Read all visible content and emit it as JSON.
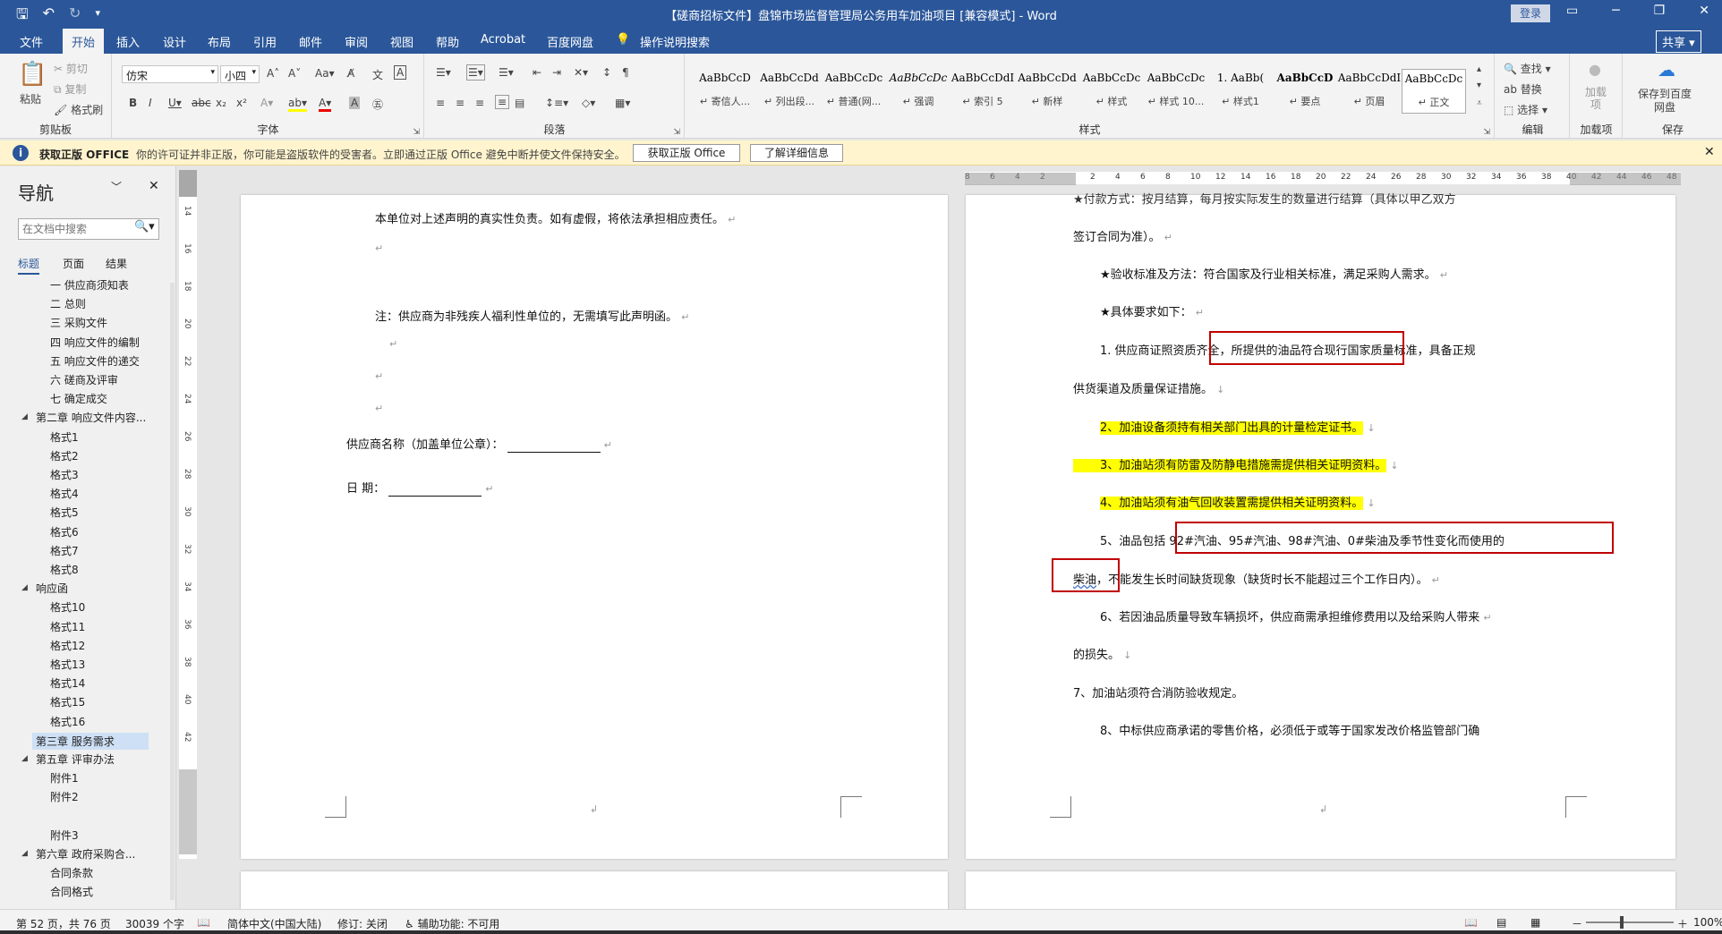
{
  "titlebar": {
    "title": "【磋商招标文件】盘锦市场监督管理局公务用车加油项目 [兼容模式] - Word",
    "login": "登录",
    "save_icon": "save-icon",
    "undo_icon": "undo-icon",
    "redo_icon": "redo-icon"
  },
  "tabs": [
    "文件",
    "开始",
    "插入",
    "设计",
    "布局",
    "引用",
    "邮件",
    "审阅",
    "视图",
    "帮助",
    "Acrobat",
    "百度网盘"
  ],
  "tell_me": "操作说明搜索",
  "share": "共享",
  "ribbon": {
    "clipboard": {
      "paste": "粘贴",
      "cut": "剪切",
      "copy": "复制",
      "format_painter": "格式刷",
      "label": "剪贴板"
    },
    "font": {
      "name": "仿宋",
      "size": "小四",
      "label": "字体"
    },
    "paragraph": {
      "label": "段落"
    },
    "styles": {
      "label": "样式",
      "items": [
        {
          "preview": "AaBbCcD",
          "name": "寄信人..."
        },
        {
          "preview": "AaBbCcDd",
          "name": "列出段..."
        },
        {
          "preview": "AaBbCcDc",
          "name": "普通(网..."
        },
        {
          "preview": "AaBbCcDc",
          "name": "强调"
        },
        {
          "preview": "AaBbCcDdI",
          "name": "索引 5"
        },
        {
          "preview": "AaBbCcDd",
          "name": "新样"
        },
        {
          "preview": "AaBbCcDc",
          "name": "样式"
        },
        {
          "preview": "AaBbCcDc",
          "name": "样式 10..."
        },
        {
          "preview": "1. AaBb(",
          "name": "样式1"
        },
        {
          "preview": "AaBbCcD",
          "name": "要点"
        },
        {
          "preview": "AaBbCcDdI",
          "name": "页眉"
        },
        {
          "preview": "AaBbCcDc",
          "name": "正文"
        }
      ]
    },
    "editing": {
      "find": "查找",
      "replace": "替换",
      "select": "选择",
      "label": "编辑"
    },
    "addins": {
      "label": "加载项",
      "btn": "加载项"
    },
    "save": {
      "btn": "保存到百度网盘",
      "label": "保存"
    }
  },
  "infobar": {
    "title": "获取正版 OFFICE",
    "message": "你的许可证并非正版，你可能是盗版软件的受害者。立即通过正版 Office 避免中断并使文件保持安全。",
    "btn1": "获取正版 Office",
    "btn2": "了解详细信息"
  },
  "nav": {
    "title": "导航",
    "search_placeholder": "在文档中搜索",
    "tabs": [
      "标题",
      "页面",
      "结果"
    ],
    "items": [
      {
        "label": "一 供应商须知表",
        "indent": 2
      },
      {
        "label": "二 总则",
        "indent": 2
      },
      {
        "label": "三 采购文件",
        "indent": 2
      },
      {
        "label": "四  响应文件的编制",
        "indent": 2
      },
      {
        "label": "五 响应文件的递交",
        "indent": 2
      },
      {
        "label": "六 磋商及评审",
        "indent": 2
      },
      {
        "label": "七 确定成交",
        "indent": 2
      },
      {
        "label": "第二章 响应文件内容...",
        "indent": 1,
        "expand": true
      },
      {
        "label": "格式1",
        "indent": 2
      },
      {
        "label": "格式2",
        "indent": 2
      },
      {
        "label": "格式3",
        "indent": 2
      },
      {
        "label": "格式4",
        "indent": 2
      },
      {
        "label": "格式5",
        "indent": 2
      },
      {
        "label": "格式6",
        "indent": 2
      },
      {
        "label": "格式7",
        "indent": 2
      },
      {
        "label": "格式8",
        "indent": 2
      },
      {
        "label": "响应函",
        "indent": 1,
        "expand": true
      },
      {
        "label": "格式10",
        "indent": 2
      },
      {
        "label": "格式11",
        "indent": 2
      },
      {
        "label": "格式12",
        "indent": 2
      },
      {
        "label": "格式13",
        "indent": 2
      },
      {
        "label": "格式14",
        "indent": 2
      },
      {
        "label": "格式15",
        "indent": 2
      },
      {
        "label": "格式16",
        "indent": 2
      },
      {
        "label": "第三章  服务需求",
        "indent": 1,
        "selected": true
      },
      {
        "label": "第五章 评审办法",
        "indent": 1,
        "expand": true
      },
      {
        "label": "附件1",
        "indent": 2
      },
      {
        "label": "附件2",
        "indent": 2
      },
      {
        "label": "",
        "indent": 2
      },
      {
        "label": "附件3",
        "indent": 2
      },
      {
        "label": "第六章  政府采购合...",
        "indent": 1,
        "expand": true
      },
      {
        "label": "合同条款",
        "indent": 2
      },
      {
        "label": "合同格式",
        "indent": 2
      }
    ]
  },
  "left_page": {
    "p1": "本单位对上述声明的真实性负责。如有虚假，将依法承担相应责任。",
    "p2": "注：供应商为非残疾人福利性单位的，无需填写此声明函。",
    "p3": "供应商名称（加盖单位公章）：",
    "p4": "日  期："
  },
  "right_page": {
    "l0": "★付款方式：按月结算，每月按实际发生的数量进行结算（具体以甲乙双方",
    "l1": "签订合同为准）。",
    "l2": "★验收标准及方法：符合国家及行业相关标准，满足采购人需求。",
    "l3": "★具体要求如下：",
    "l4a": "1. 供应商证照资质齐全，",
    "l4b": "所提供的油品符合现行国家质量标准",
    "l4c": "，具备正规",
    "l5": "供货渠道及质量保证措施。",
    "l6": "2、加油设备须持有相关部门出具的计量检定证书。",
    "l7": "3、加油站须有防雷及防静电措施需提供相关证明资料。",
    "l8": "4、加油站须有油气回收装置需提供相关证明资料。",
    "l9a": "5、油品包括",
    "l9b": "92#汽油、95#汽油、98#汽油、0#柴油及季节性变化而使用的",
    "l10a": "柴油",
    "l10b": "，不能发生长时间缺货现象（缺货时长不能超过三个工作日内）。",
    "l11": "6、若因油品质量导致车辆损坏，供应商需承担维修费用以及给采购人带来",
    "l12": "的损失。",
    "l13": "7、加油站须符合消防验收规定。",
    "l14": "8、中标供应商承诺的零售价格，必须低于或等于国家发改价格监管部门确"
  },
  "hruler_ticks": [
    "8",
    "6",
    "4",
    "2",
    "",
    "2",
    "4",
    "6",
    "8",
    "10",
    "12",
    "14",
    "16",
    "18",
    "20",
    "22",
    "24",
    "26",
    "28",
    "30",
    "32",
    "34",
    "36",
    "38",
    "40",
    "42",
    "44",
    "46",
    "48"
  ],
  "status": {
    "page": "第 52 页，共 76 页",
    "words": "30039 个字",
    "lang": "简体中文(中国大陆)",
    "track": "修订: 关闭",
    "access": "辅助功能: 不可用",
    "zoom": "100%"
  }
}
